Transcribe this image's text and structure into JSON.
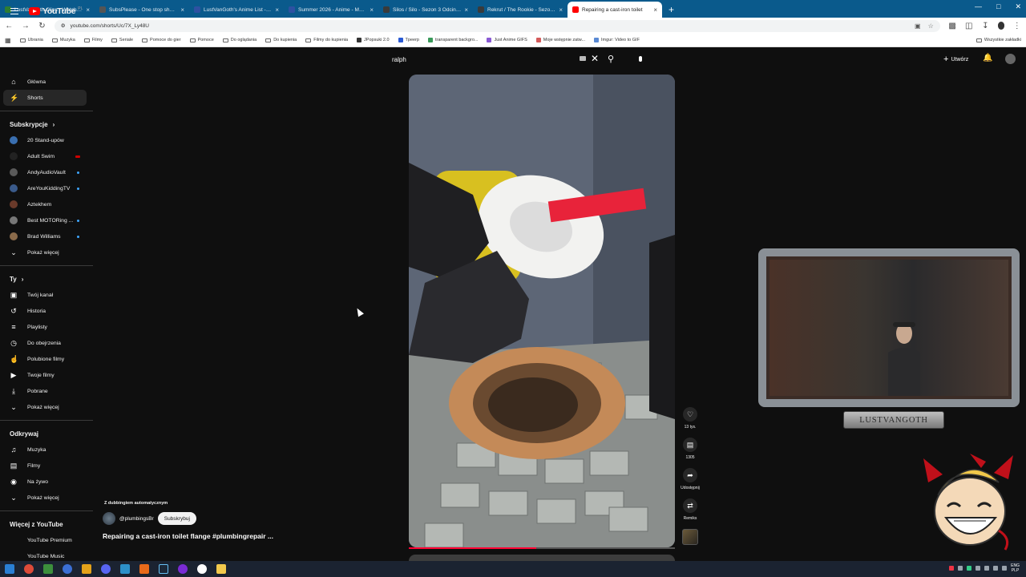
{
  "browser": {
    "tabs": [
      {
        "label": "LustVanGoth Clips - Watch Live",
        "color": "#2e7d32"
      },
      {
        "label": "SubsPlease - One stop shop fo",
        "color": "#555555"
      },
      {
        "label": "LustVanGoth's Anime List - My",
        "color": "#2e51a2"
      },
      {
        "label": "Summer 2026 - Anime - MyAni",
        "color": "#2e51a2"
      },
      {
        "label": "Silos / Silo - Sezon 3 Odcinek 2",
        "color": "#3a3a3a"
      },
      {
        "label": "Rekrut / The Rookie - Sezon 2",
        "color": "#3a3a3a"
      },
      {
        "label": "Repairing a cast-iron toilet",
        "color": "#ff0000",
        "active": true
      }
    ],
    "new_tab": "+",
    "url": "youtube.com/shorts/Uc/7X_Ly48U",
    "bookmarks": [
      {
        "label": "Ubrania",
        "type": "folder"
      },
      {
        "label": "Muzyka",
        "type": "folder"
      },
      {
        "label": "Filmy",
        "type": "folder"
      },
      {
        "label": "Seriale",
        "type": "folder"
      },
      {
        "label": "Pomoce do gier",
        "type": "folder"
      },
      {
        "label": "Pomoce",
        "type": "folder"
      },
      {
        "label": "Do oglądania",
        "type": "folder"
      },
      {
        "label": "Do kupienia",
        "type": "folder"
      },
      {
        "label": "Filmy do kupienia",
        "type": "folder"
      },
      {
        "label": "JPopsuki 2.0",
        "type": "site"
      },
      {
        "label": "Tpeerp",
        "type": "site"
      },
      {
        "label": "transparent backgro...",
        "type": "site"
      },
      {
        "label": "Just Anime GIFS",
        "type": "site"
      },
      {
        "label": "Moje wstępnie zatw...",
        "type": "site"
      },
      {
        "label": "Imgur: Video to GIF",
        "type": "site"
      }
    ],
    "all_bookmarks": "Wszystkie zakładki"
  },
  "youtube": {
    "logo_text": "YouTube",
    "country": "PL",
    "search_value": "ralph",
    "create_label": "Utwórz",
    "nav": [
      {
        "label": "Główna",
        "icon": "home-icon"
      },
      {
        "label": "Shorts",
        "icon": "shorts-icon",
        "active": true
      }
    ],
    "subscriptions_title": "Subskrypcje",
    "subscriptions": [
      {
        "label": "20 Stand-upów",
        "color": "#3a6fb0",
        "badge": "none"
      },
      {
        "label": "Adult Swim",
        "color": "#222222",
        "badge": "live"
      },
      {
        "label": "AndyAudioVault",
        "color": "#5a5a5a",
        "badge": "new"
      },
      {
        "label": "AreYouKiddingTV",
        "color": "#3a5a8a",
        "badge": "new"
      },
      {
        "label": "Aztekhem",
        "color": "#6a3a2a",
        "badge": "none"
      },
      {
        "label": "Best MOTORing ...",
        "color": "#777777",
        "badge": "new"
      },
      {
        "label": "Brad Williams",
        "color": "#8a6a4a",
        "badge": "new"
      }
    ],
    "show_more": "Pokaż więcej",
    "you_title": "Ty",
    "you_items": [
      {
        "label": "Twój kanał",
        "icon": "channel-icon"
      },
      {
        "label": "Historia",
        "icon": "history-icon"
      },
      {
        "label": "Playlisty",
        "icon": "playlist-icon"
      },
      {
        "label": "Do obejrzenia",
        "icon": "watch-later-icon"
      },
      {
        "label": "Polubione filmy",
        "icon": "like-icon"
      },
      {
        "label": "Twoje filmy",
        "icon": "your-videos-icon"
      },
      {
        "label": "Pobrane",
        "icon": "download-icon"
      }
    ],
    "explore_title": "Odkrywaj",
    "explore_items": [
      {
        "label": "Muzyka",
        "icon": "music-icon"
      },
      {
        "label": "Filmy",
        "icon": "movies-icon"
      },
      {
        "label": "Na żywo",
        "icon": "live-icon"
      }
    ],
    "more_title": "Więcej z YouTube",
    "more_items": [
      {
        "label": "YouTube Premium",
        "icon": "youtube-premium-icon"
      },
      {
        "label": "YouTube Music",
        "icon": "youtube-music-icon"
      }
    ],
    "short": {
      "dub_note": "Z dubbingiem automatycznym",
      "channel": "@plumbingsBr",
      "subscribe_label": "Subskrybuj",
      "title": "Repairing a cast-iron toilet flange #plumbingrepair ...",
      "progress": 0.48,
      "likes": "13 tys.",
      "comments": "1305",
      "share_label": "Udostępnij",
      "remix_label": "Remiks"
    }
  },
  "overlay": {
    "streamer_name": "LUSTVANGOTH"
  },
  "taskbar": {
    "lang_top": "ENG",
    "lang_bottom": "PLP"
  }
}
